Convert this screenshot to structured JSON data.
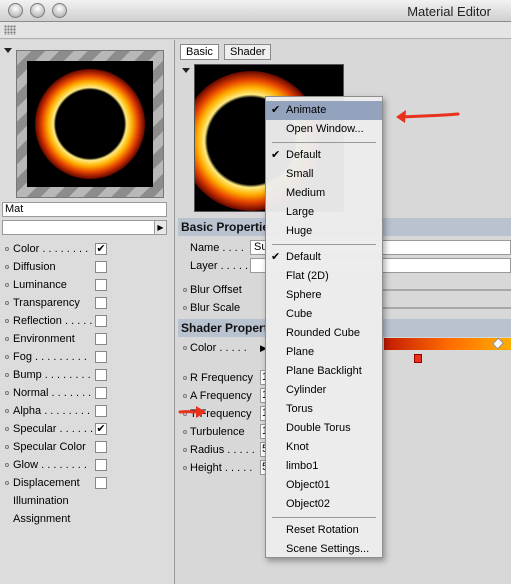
{
  "window": {
    "title": "Material Editor"
  },
  "material": {
    "name": "Mat"
  },
  "channels": [
    {
      "label": "Color . . . . . . . .",
      "checked": true
    },
    {
      "label": "Diffusion",
      "checked": false
    },
    {
      "label": "Luminance",
      "checked": false
    },
    {
      "label": "Transparency",
      "checked": false
    },
    {
      "label": "Reflection . . . . .",
      "checked": false
    },
    {
      "label": "Environment",
      "checked": false
    },
    {
      "label": "Fog . . . . . . . . .",
      "checked": false
    },
    {
      "label": "Bump . . . . . . . .",
      "checked": false
    },
    {
      "label": "Normal . . . . . . .",
      "checked": false
    },
    {
      "label": "Alpha . . . . . . . .",
      "checked": false
    },
    {
      "label": "Specular . . . . . .",
      "checked": true
    },
    {
      "label": "Specular Color",
      "checked": false
    },
    {
      "label": "Glow . . . . . . . .",
      "checked": false
    },
    {
      "label": "Displacement",
      "checked": false
    }
  ],
  "extras": [
    "Illumination",
    "Assignment"
  ],
  "tabs": [
    "Basic",
    "Shader"
  ],
  "basic": {
    "header": "Basic Propertie",
    "rows": [
      {
        "label": "Name . . . .",
        "value": "Su"
      },
      {
        "label": "Layer . . . . .",
        "value": ""
      },
      {
        "label": "Blur Offset",
        "value": ""
      },
      {
        "label": "Blur Scale",
        "value": ""
      }
    ]
  },
  "shader": {
    "header": "Shader Propert",
    "color_label": "Color . . . . .",
    "rows": [
      {
        "label": "R Frequency",
        "value": "1"
      },
      {
        "label": "A Frequency",
        "value": "1"
      },
      {
        "label": "T Frequency",
        "value": "1"
      },
      {
        "label": "Turbulence",
        "value": "1"
      },
      {
        "label": "Radius . . . . .",
        "value": "5"
      },
      {
        "label": "Height . . . . .",
        "value": "5"
      }
    ]
  },
  "menu": {
    "items": [
      {
        "label": "Animate",
        "checked": true,
        "highlighted": true
      },
      {
        "label": "Open Window...",
        "checked": false
      },
      {
        "sep": true
      },
      {
        "label": "Default",
        "checked": true
      },
      {
        "label": "Small",
        "checked": false
      },
      {
        "label": "Medium",
        "checked": false
      },
      {
        "label": "Large",
        "checked": false
      },
      {
        "label": "Huge",
        "checked": false
      },
      {
        "sep": true
      },
      {
        "label": "Default",
        "checked": true
      },
      {
        "label": "Flat (2D)",
        "checked": false
      },
      {
        "label": "Sphere",
        "checked": false
      },
      {
        "label": "Cube",
        "checked": false
      },
      {
        "label": "Rounded Cube",
        "checked": false
      },
      {
        "label": "Plane",
        "checked": false
      },
      {
        "label": "Plane Backlight",
        "checked": false
      },
      {
        "label": "Cylinder",
        "checked": false
      },
      {
        "label": "Torus",
        "checked": false
      },
      {
        "label": "Double Torus",
        "checked": false
      },
      {
        "label": "Knot",
        "checked": false
      },
      {
        "label": "limbo1",
        "checked": false
      },
      {
        "label": "Object01",
        "checked": false
      },
      {
        "label": "Object02",
        "checked": false
      },
      {
        "sep": true
      },
      {
        "label": "Reset Rotation",
        "checked": false
      },
      {
        "label": "Scene Settings...",
        "checked": false
      }
    ],
    "check_glyph": "✔"
  },
  "colors": {
    "annotation_arrow": "#e8321e",
    "menu_highlight": "#93a2bd",
    "section_header": "#b9c2cf"
  }
}
